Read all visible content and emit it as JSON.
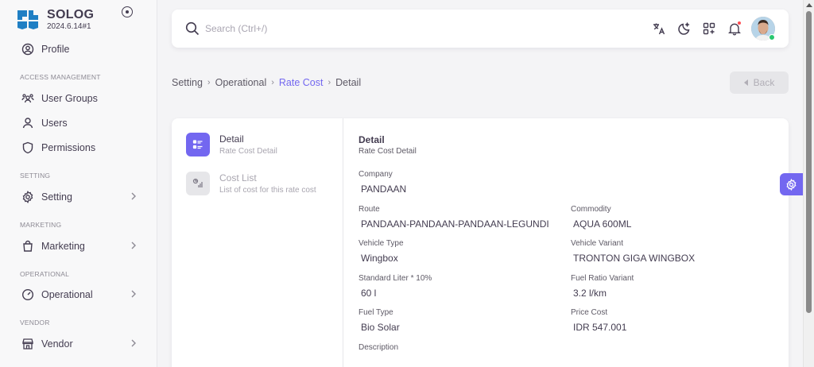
{
  "brand": {
    "name": "SOLOG",
    "version": "2024.6.14#1"
  },
  "sidebar": {
    "profile": "Profile",
    "sections": {
      "access": "ACCESS MANAGEMENT",
      "setting": "SETTING",
      "marketing": "MARKETING",
      "operational": "OPERATIONAL",
      "vendor": "VENDOR"
    },
    "items": {
      "user_groups": "User Groups",
      "users": "Users",
      "permissions": "Permissions",
      "setting": "Setting",
      "marketing": "Marketing",
      "operational": "Operational",
      "vendor": "Vendor"
    }
  },
  "topbar": {
    "search_placeholder": "Search (Ctrl+/)",
    "icons": [
      "translate-icon",
      "theme-moon-icon",
      "shortcuts-icon",
      "notification-bell-icon"
    ]
  },
  "breadcrumb": {
    "items": [
      "Setting",
      "Operational",
      "Rate Cost",
      "Detail"
    ],
    "active_index": 2
  },
  "back_button": {
    "label": "Back"
  },
  "steps": [
    {
      "title": "Detail",
      "subtitle": "Rate Cost Detail"
    },
    {
      "title": "Cost List",
      "subtitle": "List of cost for this rate cost"
    }
  ],
  "detail": {
    "title": "Detail",
    "subtitle": "Rate Cost Detail",
    "fields": {
      "company": {
        "label": "Company",
        "value": "PANDAAN"
      },
      "route": {
        "label": "Route",
        "value": "PANDAAN-PANDAAN-PANDAAN-LEGUNDI"
      },
      "commodity": {
        "label": "Commodity",
        "value": "AQUA 600ML"
      },
      "vehicle_type": {
        "label": "Vehicle Type",
        "value": "Wingbox"
      },
      "vehicle_variant": {
        "label": "Vehicle Variant",
        "value": "TRONTON GIGA WINGBOX"
      },
      "standard_liter": {
        "label": "Standard Liter * 10%",
        "value": "60 l"
      },
      "fuel_ratio": {
        "label": "Fuel Ratio Variant",
        "value": "3.2 l/km"
      },
      "fuel_type": {
        "label": "Fuel Type",
        "value": "Bio Solar"
      },
      "price_cost": {
        "label": "Price Cost",
        "value": "IDR 547.001"
      },
      "description": {
        "label": "Description",
        "value": ""
      }
    }
  },
  "colors": {
    "primary": "#7367f0",
    "text": "#433c50",
    "muted": "#a8a5af",
    "status_online": "#28c76f",
    "notification": "#ff4c51"
  }
}
